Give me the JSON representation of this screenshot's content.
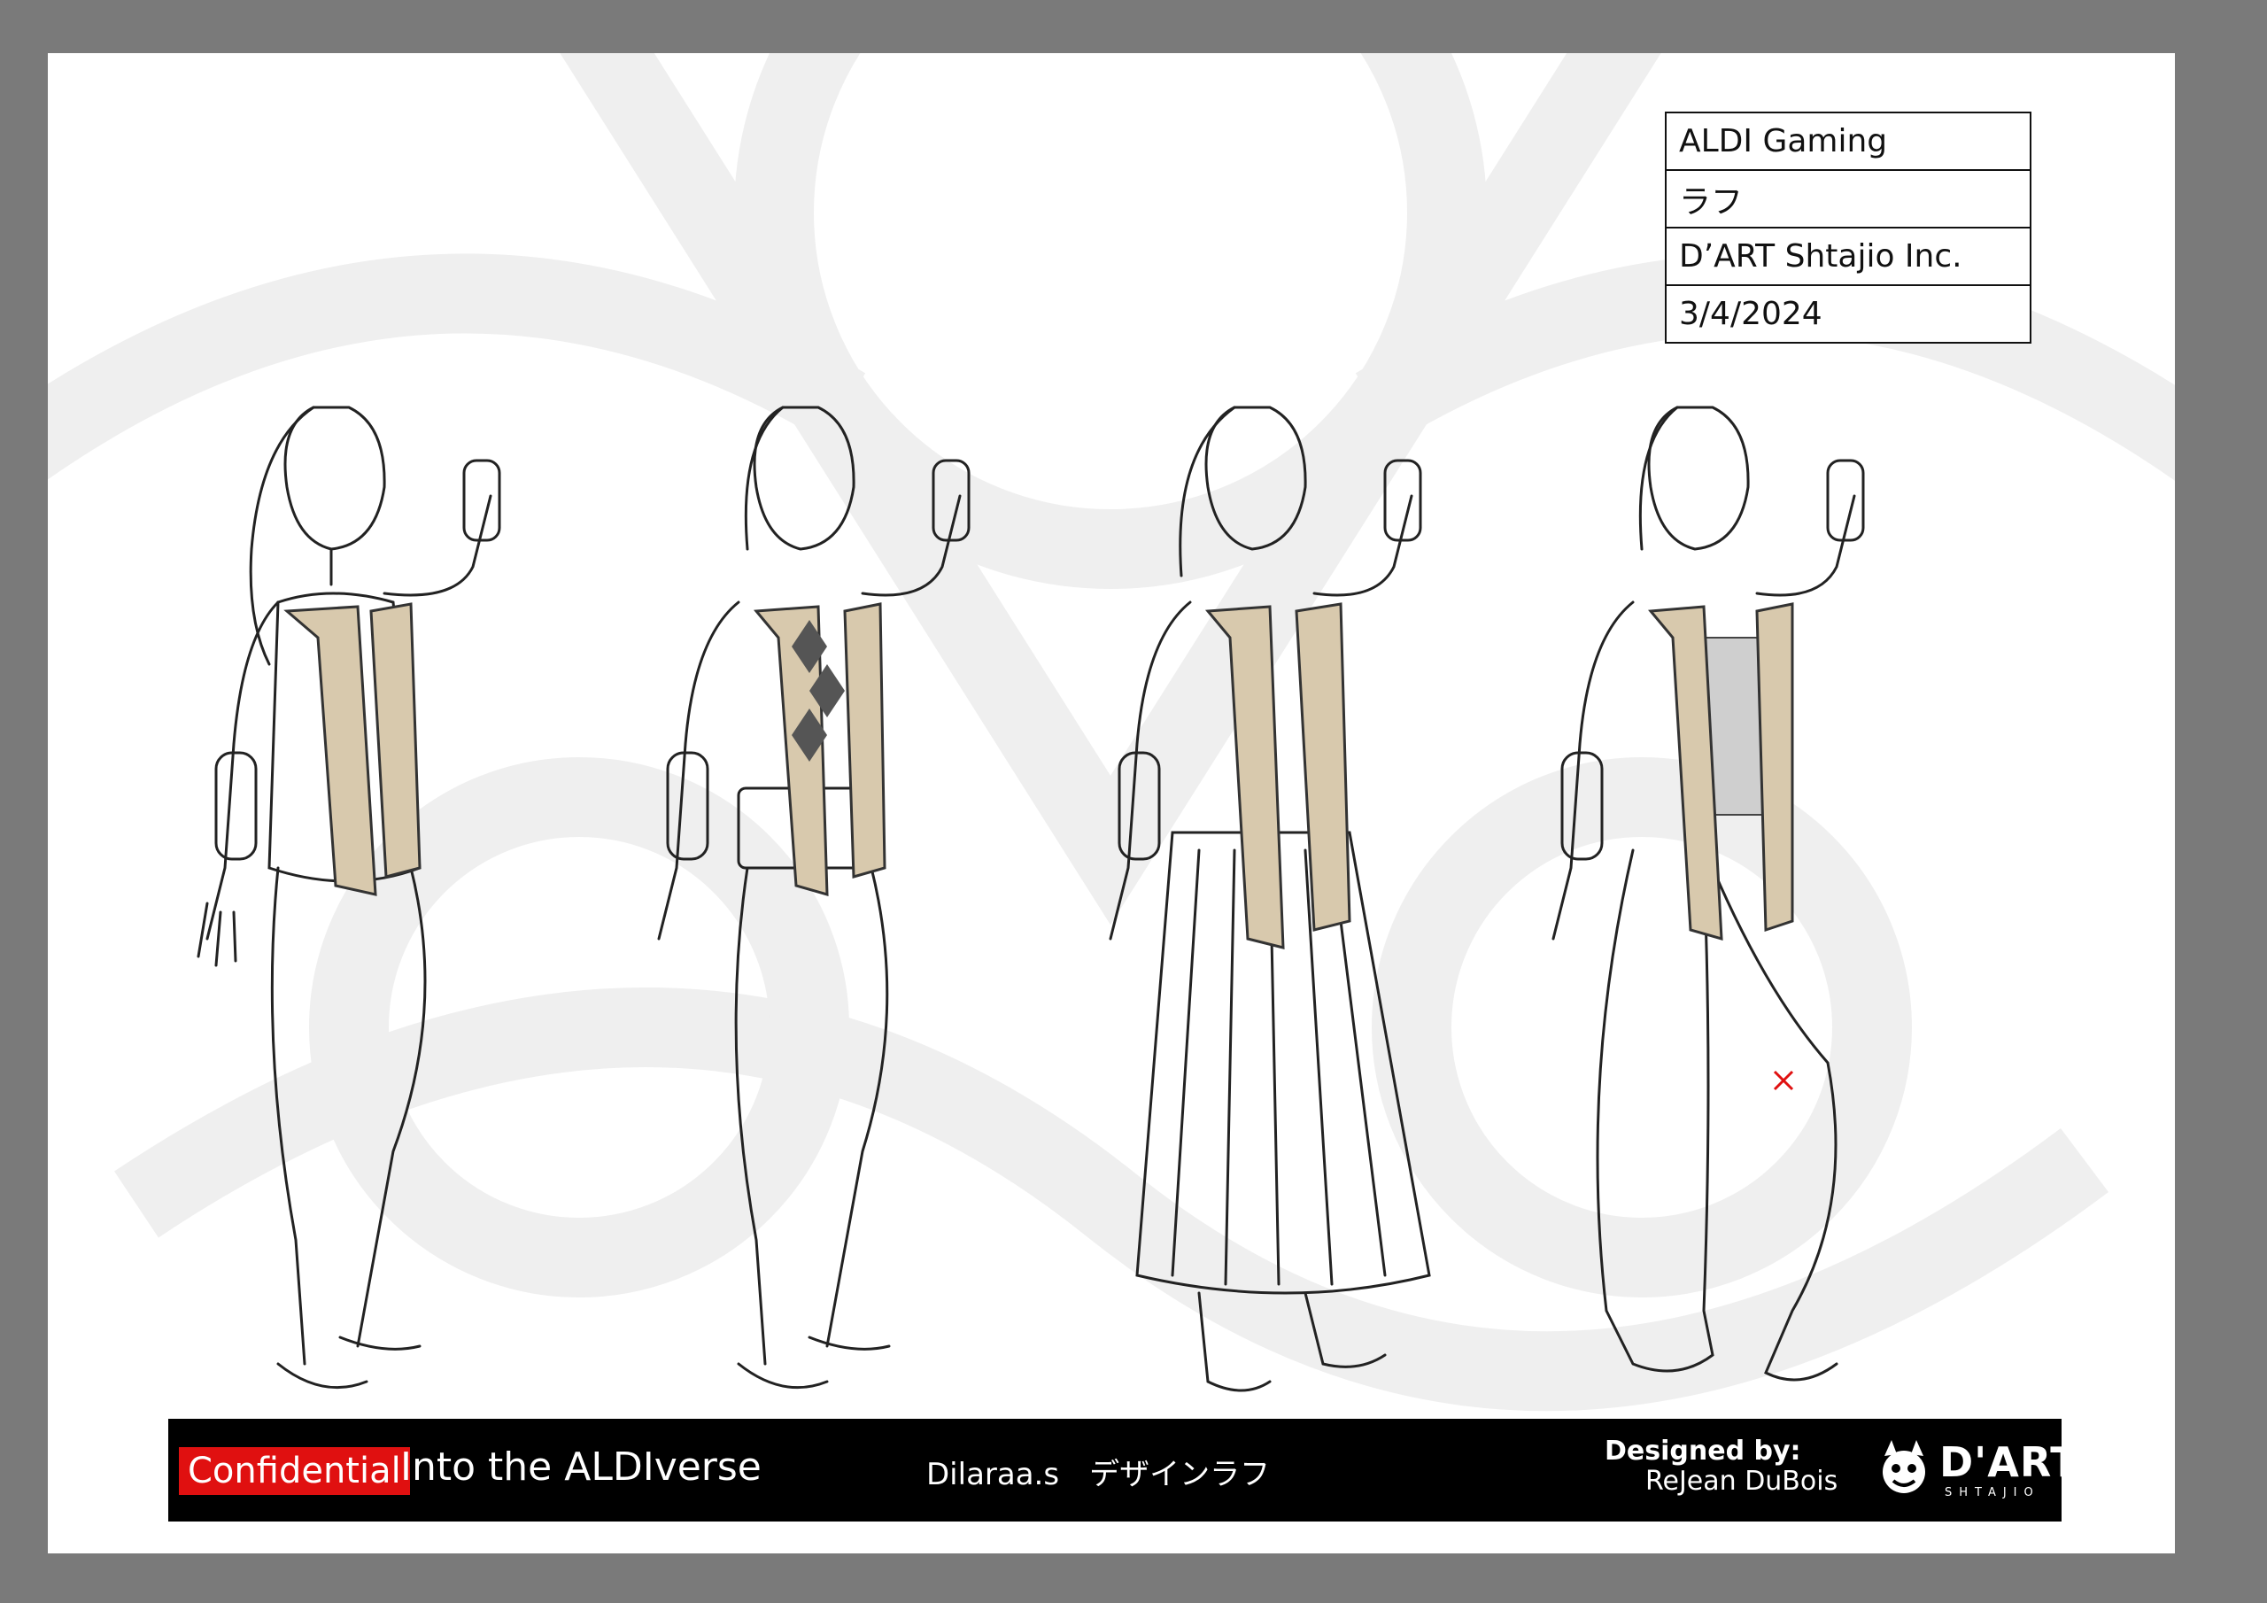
{
  "info_table": {
    "client": "ALDI Gaming",
    "stage": "ラフ",
    "studio": "D’ART Shtajio Inc.",
    "date": "3/4/2024"
  },
  "footer": {
    "confidential": "Confidential",
    "project": "Into the ALDIverse",
    "design": "Dilaraa.s　デザインラフ",
    "designed_by": "Designed by:",
    "designer": "ReJean DuBois",
    "logo_word": "D'ART",
    "logo_sub": "SHTAJIO"
  },
  "colors": {
    "frame": "#7a7a7a",
    "vest": "#d8c9ad",
    "accent_red": "#e01010",
    "footer_bg": "#000000"
  },
  "figures": [
    {
      "outfit": "vest-and-pleated-skirt"
    },
    {
      "outfit": "argyle-vest-and-shorts"
    },
    {
      "outfit": "long-pleated-skirt"
    },
    {
      "outfit": "jogger-pants"
    }
  ]
}
